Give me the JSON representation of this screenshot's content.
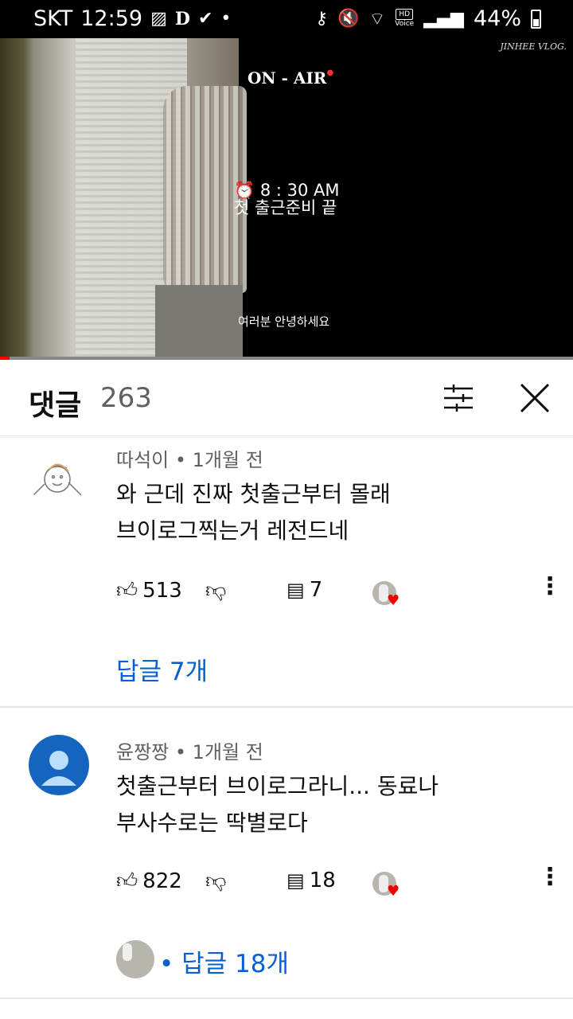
{
  "status_bar": {
    "carrier": "SKT",
    "time": "12:59",
    "battery": "44%",
    "hd_label": "HD",
    "voice_label": "Voice",
    "icons": [
      "image-icon",
      "d-icon",
      "download-check-icon",
      "dot-icon",
      "key-icon",
      "mute-icon",
      "wifi-icon",
      "signal-icon",
      "battery-icon"
    ]
  },
  "video": {
    "title": "ON - AIR",
    "channel_watermark": "JINHEE VLOG.",
    "time_caption": "⏰ 8 : 30 AM",
    "caption": "첫 출근준비 끝",
    "subtitle": "여러분 안녕하세요",
    "progress_fraction": 0.017
  },
  "comments_header": {
    "title": "댓글",
    "count": "263"
  },
  "comments": [
    {
      "author": "따석이",
      "time": "1개월 전",
      "text_line1": "와 근데 진짜 첫출근부터 몰래",
      "text_line2": "브이로그찍는거 레전드네",
      "likes": "513",
      "replies_count": "7",
      "replies_label": "답글 7개"
    },
    {
      "author": "윤짱짱",
      "time": "1개월 전",
      "text_line1": "첫출근부터 브이로그라니... 동료나",
      "text_line2": "부사수로는 딱별로다",
      "likes": "822",
      "replies_count": "18",
      "replies_label": "답글 18개"
    }
  ],
  "colors": {
    "link_blue": "#065fd4",
    "progress_red": "#ff0000",
    "avatar_blue": "#1565c0",
    "heart_red": "#e00000"
  }
}
